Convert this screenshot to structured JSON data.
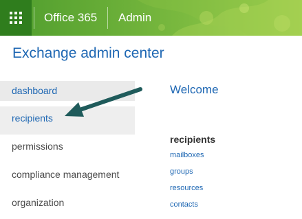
{
  "topbar": {
    "brand": "Office 365",
    "section": "Admin"
  },
  "page": {
    "title": "Exchange admin center"
  },
  "nav": {
    "items": [
      {
        "label": "dashboard"
      },
      {
        "label": "recipients"
      },
      {
        "label": "permissions"
      },
      {
        "label": "compliance management"
      },
      {
        "label": "organization"
      }
    ]
  },
  "main": {
    "welcome": "Welcome",
    "recipients_heading": "recipients",
    "links": [
      {
        "label": "mailboxes"
      },
      {
        "label": "groups"
      },
      {
        "label": "resources"
      },
      {
        "label": "contacts"
      }
    ]
  },
  "colors": {
    "topbar_green": "#63aa35",
    "waffle_green": "#2f7d1d",
    "accent_blue": "#1e67b3",
    "arrow_teal": "#1f5b5b"
  },
  "icons": {
    "app_launcher": "waffle-icon",
    "annotation": "arrow-icon"
  }
}
